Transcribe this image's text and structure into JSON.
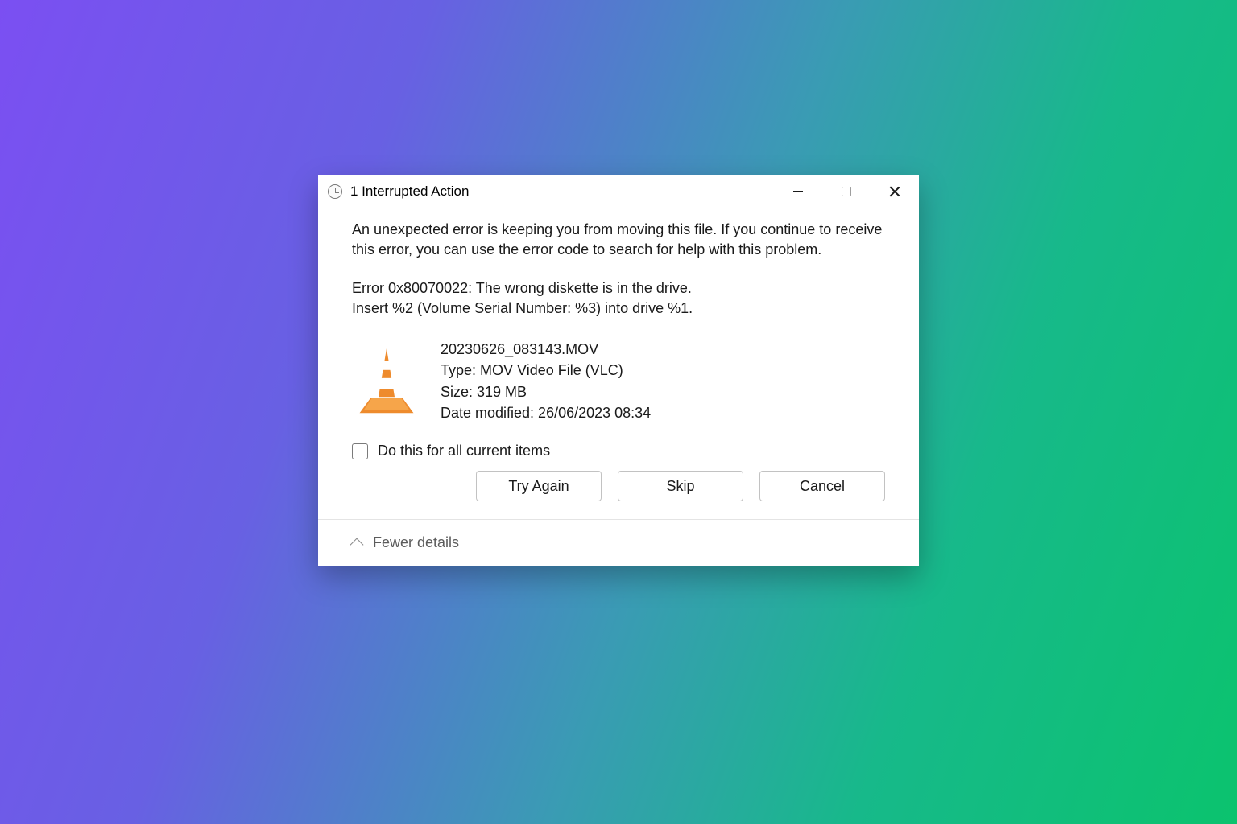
{
  "window": {
    "title": "1 Interrupted Action"
  },
  "body": {
    "intro": "An unexpected error is keeping you from moving this file. If you continue to receive this error, you can use the error code to search for help with this problem.",
    "error_line_1": "Error 0x80070022: The wrong diskette is in the drive.",
    "error_line_2": "Insert %2 (Volume Serial Number: %3) into drive %1."
  },
  "file": {
    "name": "20230626_083143.MOV",
    "type_label": "Type: MOV Video File (VLC)",
    "size_label": "Size: 319 MB",
    "modified_label": "Date modified: 26/06/2023 08:34"
  },
  "checkbox": {
    "label": "Do this for all current items"
  },
  "buttons": {
    "try_again": "Try Again",
    "skip": "Skip",
    "cancel": "Cancel"
  },
  "footer": {
    "fewer": "Fewer details"
  }
}
